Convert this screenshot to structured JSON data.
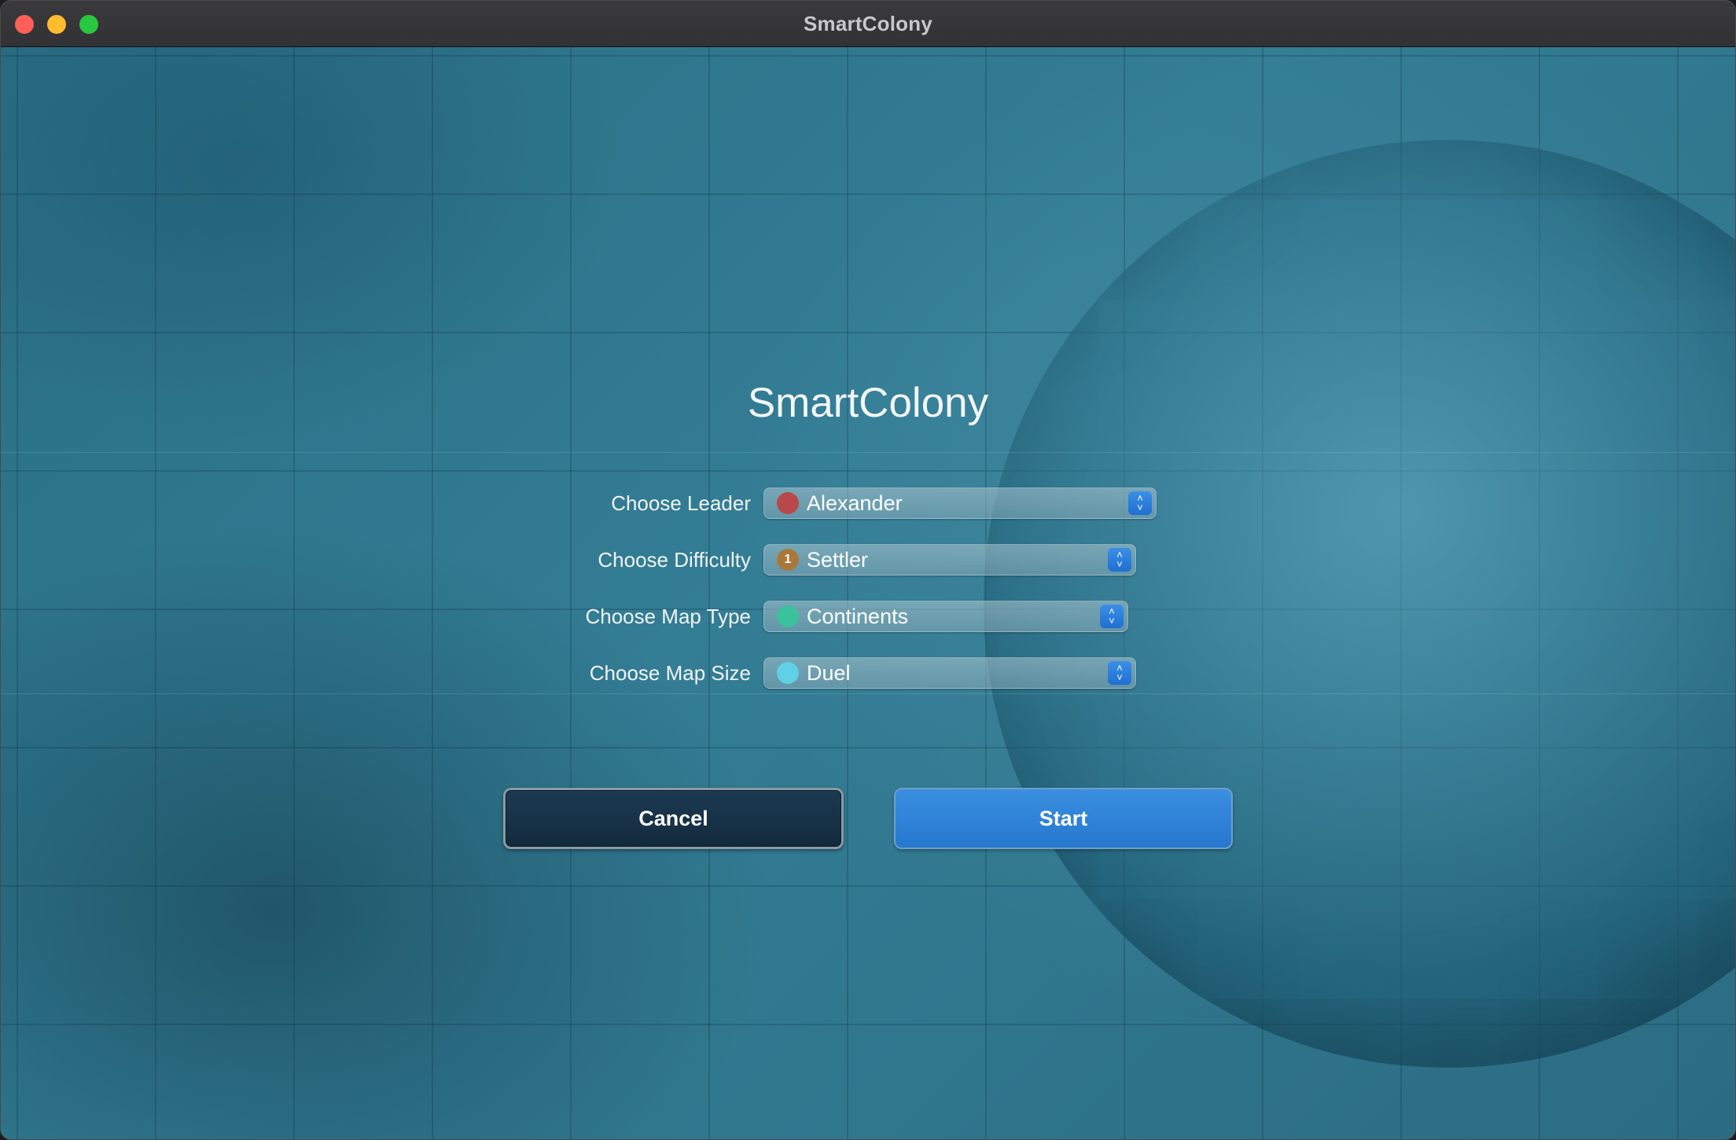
{
  "window": {
    "title": "SmartColony"
  },
  "main": {
    "heading": "SmartColony",
    "fields": [
      {
        "label": "Choose Leader",
        "value": "Alexander",
        "icon": "leader-portrait-icon",
        "icon_color": "#b8484a"
      },
      {
        "label": "Choose Difficulty",
        "value": "Settler",
        "icon": "difficulty-coin-icon",
        "icon_color": "#a9773a",
        "icon_glyph": "1"
      },
      {
        "label": "Choose Map Type",
        "value": "Continents",
        "icon": "map-continents-icon",
        "icon_color": "#3cc29a"
      },
      {
        "label": "Choose Map Size",
        "value": "Duel",
        "icon": "map-size-icon",
        "icon_color": "#5fd0e6"
      }
    ],
    "buttons": {
      "cancel": "Cancel",
      "start": "Start"
    }
  },
  "colors": {
    "accent": "#2677cf",
    "background": "#2b6f86"
  }
}
